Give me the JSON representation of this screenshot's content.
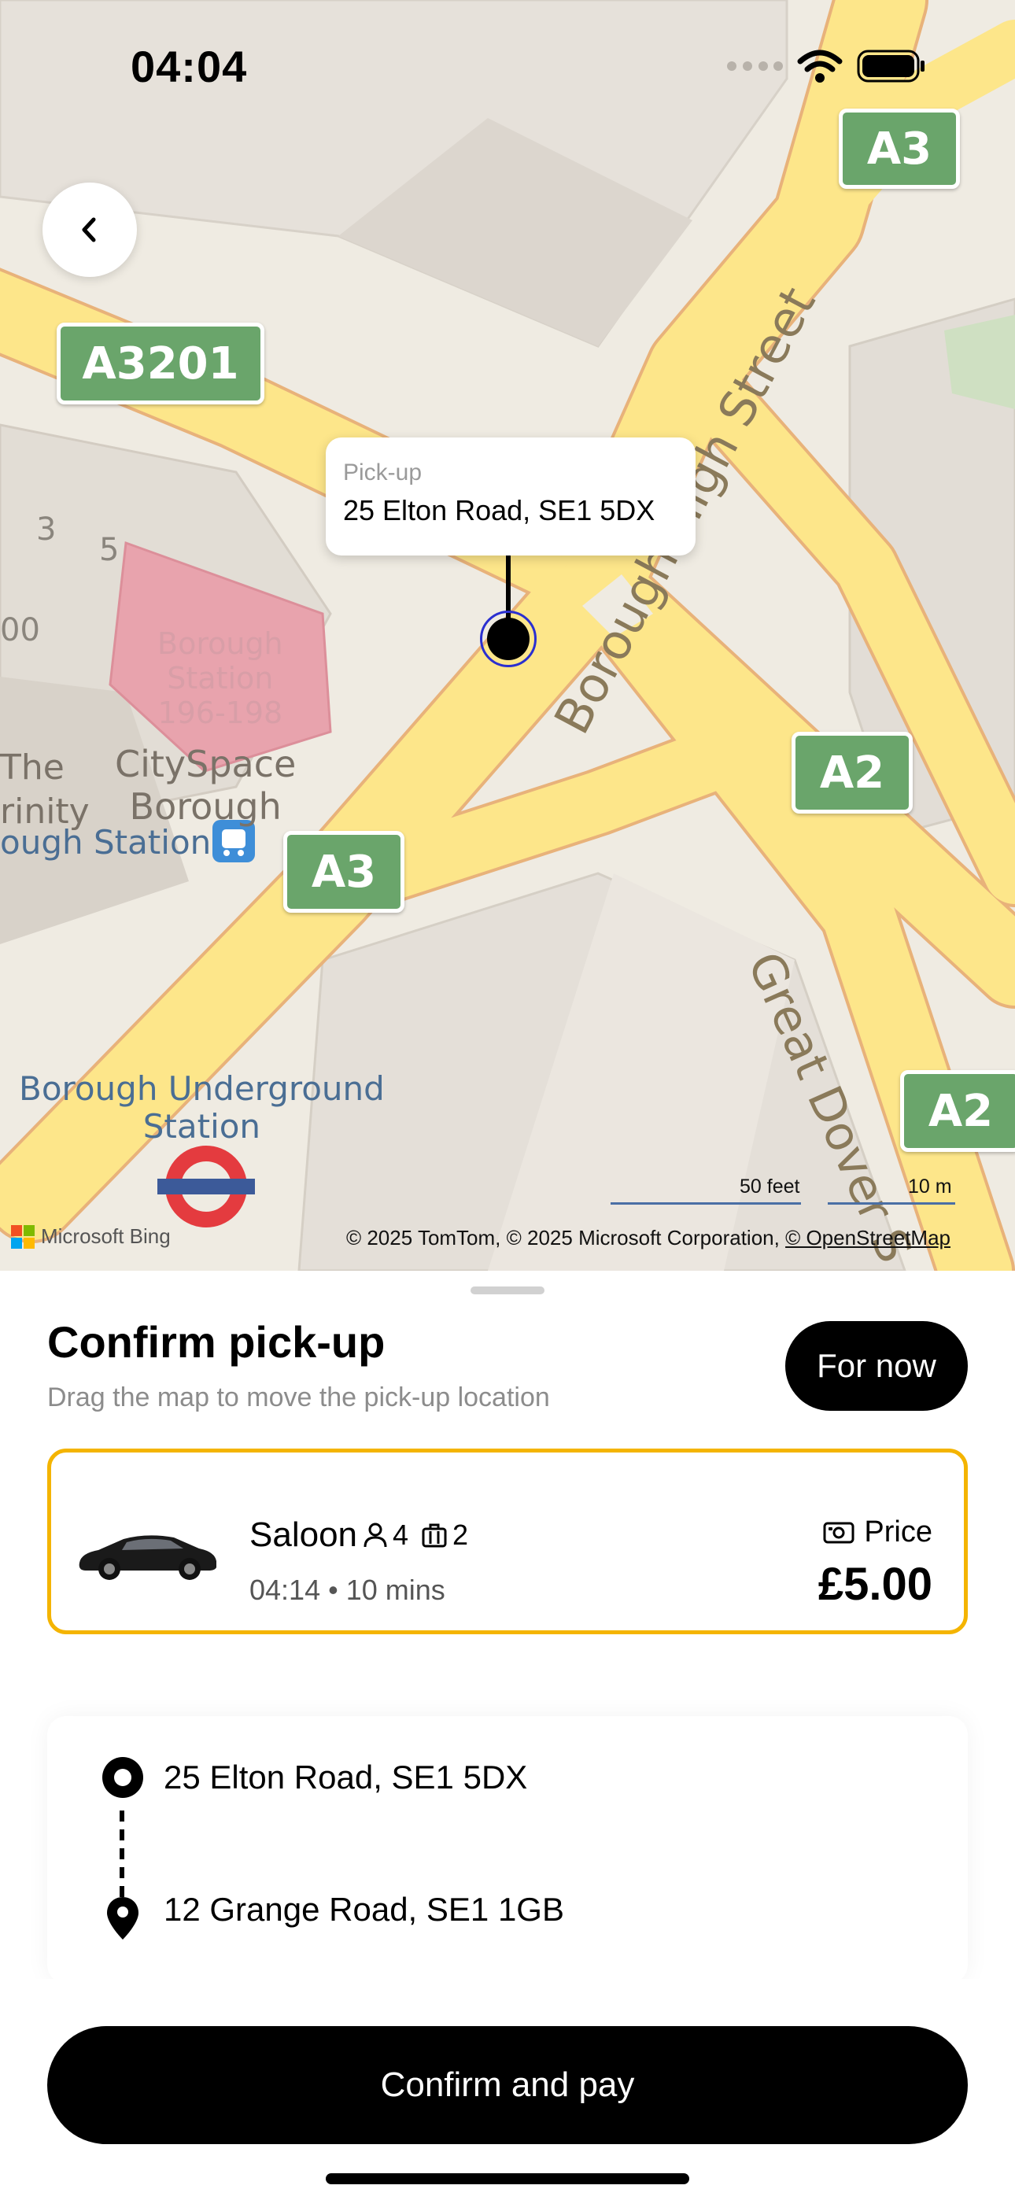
{
  "status_bar": {
    "time": "04:04"
  },
  "map": {
    "road_shields": [
      "A3",
      "A3201",
      "A2",
      "A3",
      "A2"
    ],
    "street_labels": {
      "borough_high_street": "Borough High Street",
      "great_dover": "Great Dover S"
    },
    "poi_labels": {
      "borough_station_block": "Borough\nStation\n196-198",
      "cityspace": "CitySpace\nBorough",
      "the_trinity": "The\nrinity",
      "borough_station": "ough Station",
      "underground": "Borough Underground\nStation",
      "house_3": "3",
      "house_5": "5",
      "house_00": "00"
    },
    "pickup_callout": {
      "caption": "Pick-up",
      "address": "25 Elton Road, SE1 5DX"
    },
    "scale": {
      "feet": "50 feet",
      "meters": "10 m"
    },
    "bing": "Microsoft Bing",
    "attribution": "© 2025 TomTom, © 2025 Microsoft Corporation, ",
    "attribution_link": "© OpenStreetMap"
  },
  "sheet": {
    "title": "Confirm pick-up",
    "subtitle": "Drag the map to move the pick-up location",
    "for_now_label": "For now",
    "vehicle": {
      "name": "Saloon",
      "passengers": "4",
      "luggage": "2",
      "eta": "04:14 • 10 mins",
      "price_label": "Price",
      "price": "£5.00"
    },
    "route": {
      "pickup": "25 Elton Road, SE1 5DX",
      "dropoff": "12 Grange Road, SE1 1GB"
    },
    "confirm_label": "Confirm and pay"
  },
  "colors": {
    "accent_border": "#f4b400",
    "road_fill": "#fde68a",
    "shield_green": "#6aa56b",
    "button": "#000000"
  }
}
